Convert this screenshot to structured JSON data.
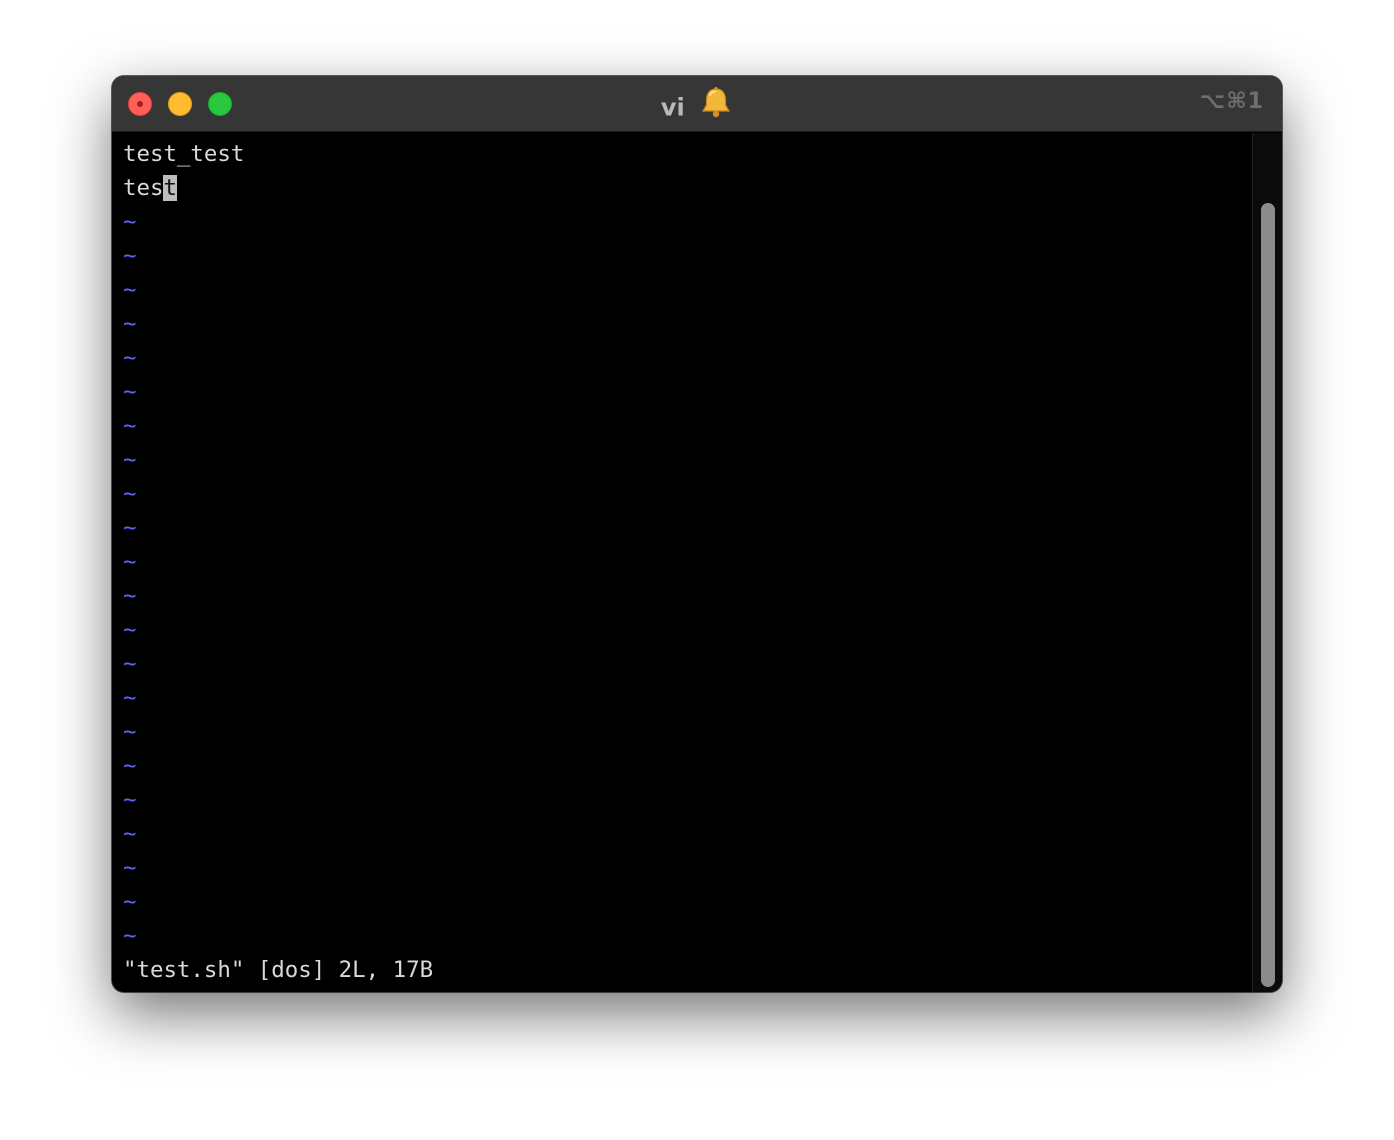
{
  "window": {
    "title": "vi",
    "title_icon": "bell-icon",
    "shortcut": "⌥⌘1"
  },
  "colors": {
    "titlebar": "#363636",
    "close": "#ff5f57",
    "minimize": "#febc2e",
    "maximize": "#28c840",
    "text": "#d9d9d9",
    "tilde": "#5c66ff",
    "cursor": "#bdbdbd"
  },
  "buffer": {
    "line1": "test_test",
    "line2_before_cursor": "tes",
    "line2_cursor_char": "t",
    "empty_marker": "~",
    "status_line": "\"test.sh\" [dos] 2L, 17B"
  }
}
